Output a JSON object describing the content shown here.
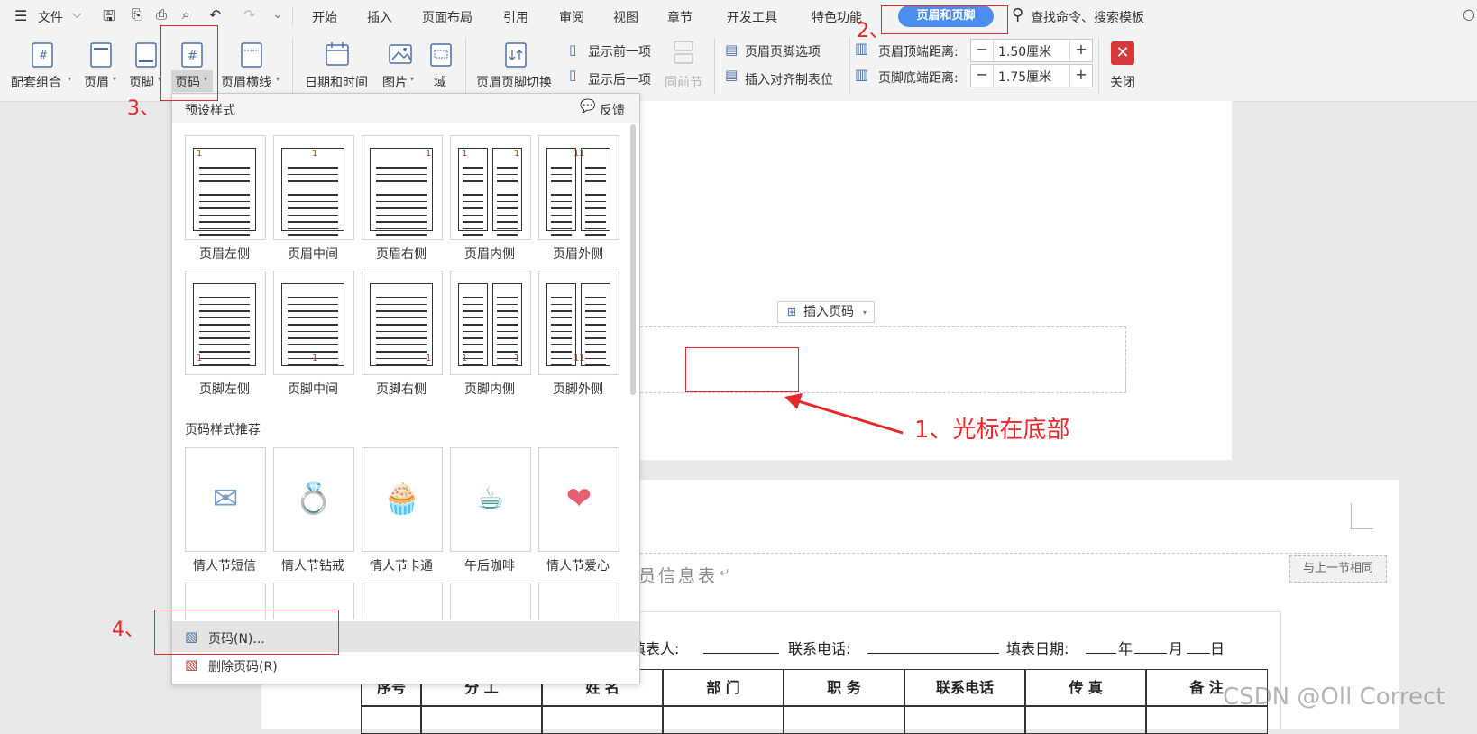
{
  "menubar": {
    "file_label": "文件",
    "tabs": [
      "开始",
      "插入",
      "页面布局",
      "引用",
      "审阅",
      "视图",
      "章节",
      "开发工具",
      "特色功能"
    ],
    "active_tab": "页眉和页脚",
    "search_placeholder": "查找命令、搜索模板"
  },
  "ribbon": {
    "combo": "配套组合",
    "header": "页眉",
    "footer": "页脚",
    "page_number": "页码",
    "header_line": "页眉横线",
    "date_time": "日期和时间",
    "picture": "图片",
    "field": "域",
    "switch": "页眉页脚切换",
    "show_prev": "显示前一项",
    "show_next": "显示后一项",
    "same_as_prev": "同前节",
    "options": "页眉页脚选项",
    "insert_tab": "插入对齐制表位",
    "header_top_label": "页眉顶端距离:",
    "header_top_value": "1.50厘米",
    "footer_bottom_label": "页脚底端距离:",
    "footer_bottom_value": "1.75厘米",
    "close": "关闭"
  },
  "dropdown": {
    "preset_title": "预设样式",
    "feedback": "反馈",
    "presets_row1": [
      "页眉左侧",
      "页眉中间",
      "页眉右侧",
      "页眉内侧",
      "页眉外侧"
    ],
    "presets_row2": [
      "页脚左侧",
      "页脚中间",
      "页脚右侧",
      "页脚内侧",
      "页脚外侧"
    ],
    "thumb_number": "1",
    "recommend_title": "页码样式推荐",
    "recommend": [
      "情人节短信",
      "情人节钻戒",
      "情人节卡通",
      "午后咖啡",
      "情人节爱心"
    ],
    "menu_page_number": "页码(N)...",
    "menu_delete": "删除页码(R)"
  },
  "document": {
    "insert_page_number_btn": "插入页码",
    "same_as_prev_section": "与上一节相同",
    "title_fragment": "员信息表",
    "form_line": {
      "filler": "填表人:",
      "phone": "联系电话:",
      "date": "填表日期:",
      "year": "年",
      "month": "月",
      "day": "日"
    },
    "table_headers": [
      "序号",
      "分 工",
      "姓 名",
      "部 门",
      "职 务",
      "联系电话",
      "传 真",
      "备 注"
    ]
  },
  "annotations": {
    "step1": "1、光标在底部",
    "step2": "2、",
    "step3": "3、",
    "step4": "4、"
  },
  "watermark": "CSDN @Oll Correct"
}
